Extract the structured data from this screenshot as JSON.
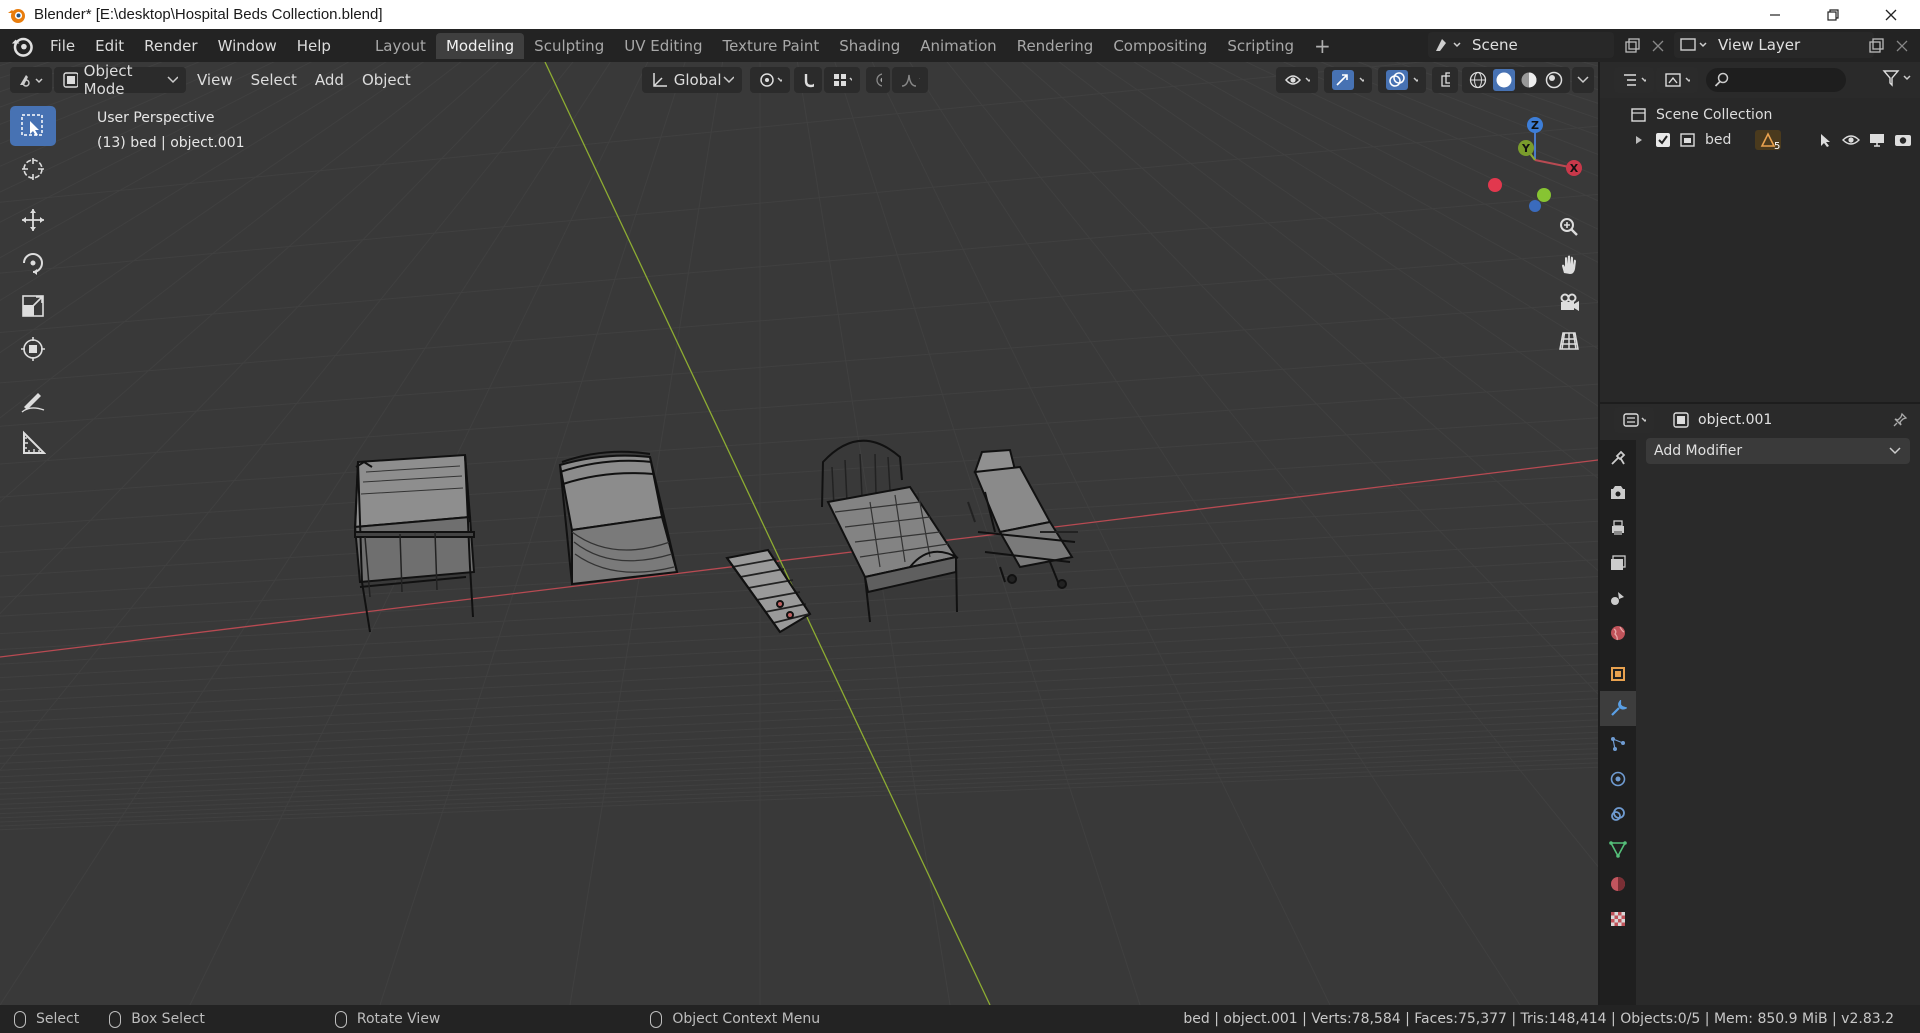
{
  "window": {
    "title": "Blender* [E:\\desktop\\Hospital Beds Collection.blend]",
    "buttons": [
      "minimize",
      "restore",
      "close"
    ]
  },
  "menus": [
    "File",
    "Edit",
    "Render",
    "Window",
    "Help"
  ],
  "workspace_tabs": [
    {
      "label": "Layout",
      "active": false
    },
    {
      "label": "Modeling",
      "active": true
    },
    {
      "label": "Sculpting",
      "active": false
    },
    {
      "label": "UV Editing",
      "active": false
    },
    {
      "label": "Texture Paint",
      "active": false
    },
    {
      "label": "Shading",
      "active": false
    },
    {
      "label": "Animation",
      "active": false
    },
    {
      "label": "Rendering",
      "active": false
    },
    {
      "label": "Compositing",
      "active": false
    },
    {
      "label": "Scripting",
      "active": false
    }
  ],
  "add_workspace": "+",
  "scene_name": "Scene",
  "view_layer": "View Layer",
  "viewport_header": {
    "mode": "Object Mode",
    "menus": [
      "View",
      "Select",
      "Add",
      "Object"
    ],
    "orientation": "Global"
  },
  "overlay_text": {
    "view_name": "User Perspective",
    "object_info": "(13) bed | object.001"
  },
  "gizmo": {
    "x": "X",
    "y": "Y",
    "z": "Z"
  },
  "outliner": {
    "search_placeholder": "",
    "root": "Scene Collection",
    "items": [
      {
        "name": "bed",
        "count": "5"
      }
    ]
  },
  "properties": {
    "object_name": "object.001",
    "add_modifier": "Add Modifier"
  },
  "statusbar": {
    "select": "Select",
    "box_select": "Box Select",
    "rotate_view": "Rotate View",
    "context_menu": "Object Context Menu",
    "stats": "bed | object.001 | Verts:78,584 | Faces:75,377 | Tris:148,414 | Objects:0/5 | Mem: 850.9 MiB | v2.83.2"
  },
  "colors": {
    "active_tab": "#3f3f3f",
    "active_tool": "#4772b3",
    "axis_x": "#b84a52",
    "axis_y": "#8dac32",
    "grid": "#404040",
    "viewport_bg": "#393939"
  }
}
